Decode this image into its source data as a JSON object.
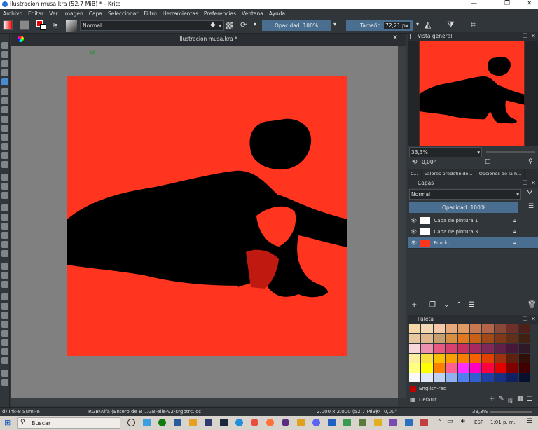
{
  "window": {
    "title": "Ilustracion musa.kra (52,7 MiB)  * - Krita"
  },
  "menu": [
    "Archivo",
    "Editar",
    "Ver",
    "Imagen",
    "Capa",
    "Seleccionar",
    "Filtro",
    "Herramientas",
    "Preferencias",
    "Ventana",
    "Ayuda"
  ],
  "toolbar": {
    "blend_mode": "Normal",
    "opacity": "Opacidad: 100%",
    "size_label": "Tamaño:",
    "size_value": "72,21 px"
  },
  "document": {
    "tab_title": "Ilustracion musa.kra *",
    "bg_color": "#ff3520",
    "ink_color": "#000000"
  },
  "overview": {
    "title": "Vista general",
    "zoom": "33,3%",
    "rotation": "0,00°"
  },
  "docker_tabs": [
    "C...",
    "Valores predefinido...",
    "Opciones de la h..."
  ],
  "layers": {
    "title": "Capas",
    "blend": "Normal",
    "opacity": "Opacidad: 100%",
    "items": [
      "Capa de pintura 1",
      "Capa de pintura 3",
      "Fondo"
    ]
  },
  "palette": {
    "title": "Paleta",
    "selected_color": "English-red",
    "palette_name": "Default",
    "swatches": [
      [
        "#f6d8a8",
        "#f4d8b4",
        "#f5c9a8",
        "#e8a878",
        "#e09a62",
        "#c87850",
        "#b46448",
        "#8a4838",
        "#6e3028",
        "#4e2018"
      ],
      [
        "#e8c8a0",
        "#e0b890",
        "#c8a070",
        "#d89040",
        "#e07820",
        "#c86018",
        "#a04818",
        "#803818",
        "#603018",
        "#402010"
      ],
      [
        "#f8d8d8",
        "#f090b0",
        "#e85880",
        "#d84070",
        "#c83060",
        "#a82860",
        "#802858",
        "#602048",
        "#481838",
        "#301828"
      ],
      [
        "#fcf0a0",
        "#f8e040",
        "#f8c000",
        "#f8a000",
        "#f88000",
        "#f86000",
        "#e04000",
        "#a03010",
        "#602010",
        "#301008"
      ],
      [
        "#ffff80",
        "#ffff00",
        "#ff8000",
        "#ff6090",
        "#ff30ff",
        "#ff00c0",
        "#ff0040",
        "#e00000",
        "#800000",
        "#400000"
      ],
      [
        "#f8f8f8",
        "#e0e8f8",
        "#c0d0f0",
        "#90b0f0",
        "#5080f0",
        "#3060d0",
        "#2040a0",
        "#183080",
        "#102060",
        "#081030"
      ]
    ]
  },
  "status": {
    "brush": "d) Ink-8 Sumi-e",
    "colorspace": "RGB/Alfa (Entero de 8 ...GB-elle-V2-srgbtrc.icc",
    "dims": "2.000 x 2.000 (52,7 MiB)",
    "rotation": "0,00°",
    "zoom": "33,3%"
  },
  "taskbar": {
    "search": "Buscar",
    "lang": "ESP",
    "time": "1:01 p. m."
  }
}
